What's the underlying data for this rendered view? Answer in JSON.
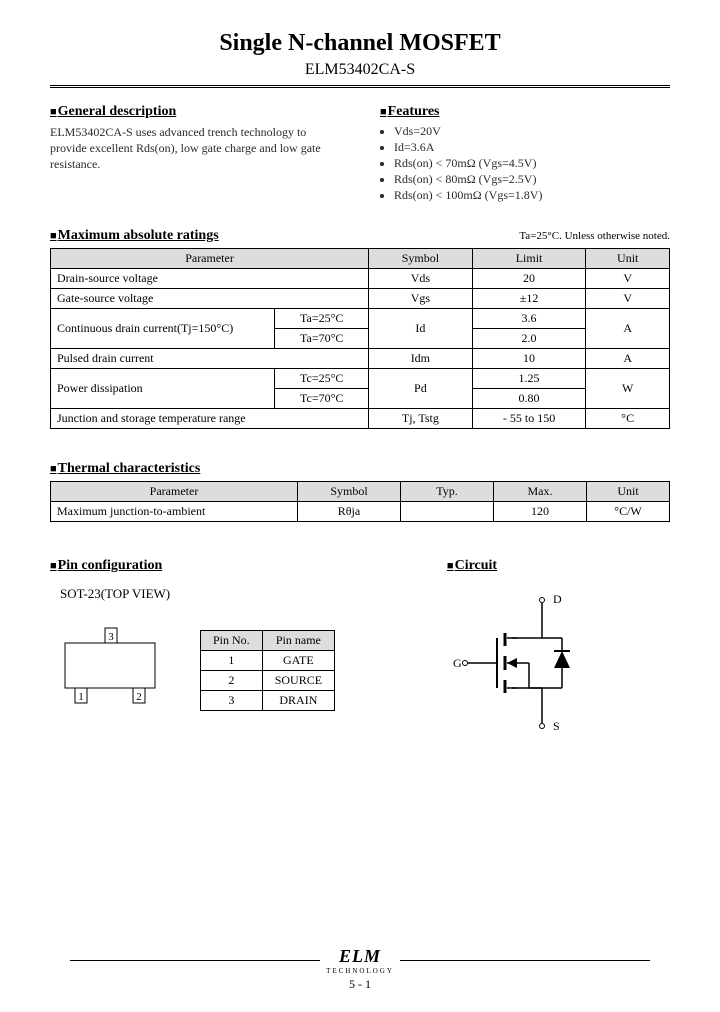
{
  "title": "Single N-channel MOSFET",
  "subtitle": "ELM53402CA-S",
  "general": {
    "heading": "General description",
    "text": "ELM53402CA-S uses advanced trench technology to provide excellent Rds(on), low gate charge and low gate resistance."
  },
  "features": {
    "heading": "Features",
    "items": [
      "Vds=20V",
      "Id=3.6A",
      "Rds(on) < 70mΩ (Vgs=4.5V)",
      "Rds(on) < 80mΩ (Vgs=2.5V)",
      "Rds(on) < 100mΩ (Vgs=1.8V)"
    ]
  },
  "max_ratings": {
    "heading": "Maximum absolute ratings",
    "note": "Ta=25°C. Unless otherwise noted.",
    "headers": [
      "Parameter",
      "Symbol",
      "Limit",
      "Unit"
    ],
    "rows": [
      {
        "param": "Drain-source voltage",
        "cond": "",
        "sym": "Vds",
        "limit": "20",
        "unit": "V"
      },
      {
        "param": "Gate-source voltage",
        "cond": "",
        "sym": "Vgs",
        "limit": "±12",
        "unit": "V"
      },
      {
        "param": "Continuous drain current(Tj=150°C)",
        "cond": "Ta=25°C",
        "sym": "Id",
        "limit": "3.6",
        "unit": "A",
        "span": 2
      },
      {
        "param": "",
        "cond": "Ta=70°C",
        "sym": "",
        "limit": "2.0",
        "unit": ""
      },
      {
        "param": "Pulsed drain current",
        "cond": "",
        "sym": "Idm",
        "limit": "10",
        "unit": "A"
      },
      {
        "param": "Power dissipation",
        "cond": "Tc=25°C",
        "sym": "Pd",
        "limit": "1.25",
        "unit": "W",
        "span": 2
      },
      {
        "param": "",
        "cond": "Tc=70°C",
        "sym": "",
        "limit": "0.80",
        "unit": ""
      },
      {
        "param": "Junction and storage temperature range",
        "cond": "",
        "sym": "Tj, Tstg",
        "limit": "- 55 to 150",
        "unit": "°C"
      }
    ]
  },
  "thermal": {
    "heading": "Thermal characteristics",
    "headers": [
      "Parameter",
      "Symbol",
      "Typ.",
      "Max.",
      "Unit"
    ],
    "rows": [
      {
        "param": "Maximum junction-to-ambient",
        "sym": "Rθja",
        "typ": "",
        "max": "120",
        "unit": "°C/W"
      }
    ]
  },
  "pinconf": {
    "heading": "Pin configuration",
    "pkg": "SOT-23(TOP VIEW)",
    "headers": [
      "Pin No.",
      "Pin name"
    ],
    "pins": [
      {
        "no": "1",
        "name": "GATE"
      },
      {
        "no": "2",
        "name": "SOURCE"
      },
      {
        "no": "3",
        "name": "DRAIN"
      }
    ],
    "pkg_pins": {
      "p1": "1",
      "p2": "2",
      "p3": "3"
    }
  },
  "circuit": {
    "heading": "Circuit",
    "labels": {
      "d": "D",
      "g": "G",
      "s": "S"
    }
  },
  "footer": {
    "logo_text": "ELM",
    "logo_sub": "TECHNOLOGY",
    "page": "5 - 1"
  }
}
